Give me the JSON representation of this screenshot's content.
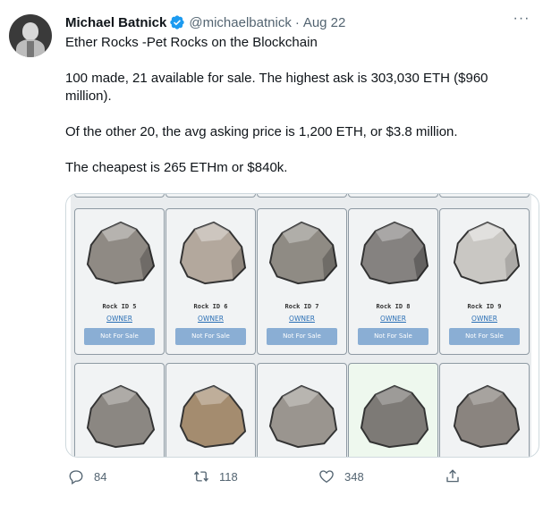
{
  "tweet": {
    "author_name": "Michael Batnick",
    "handle": "@michaelbatnick",
    "separator": "·",
    "date": "Aug 22",
    "more_label": "···",
    "lines": [
      "Ether Rocks -Pet Rocks on the Blockchain",
      "100 made, 21 available for sale. The highest ask is 303,030 ETH ($960 million).",
      "Of the other 20, the avg asking price is 1,200 ETH, or $3.8 million.",
      "The cheapest is 265 ETHm or $840k."
    ]
  },
  "media": {
    "cards": [
      {
        "rock_id": "Rock ID 5",
        "owner": "OWNER",
        "status": "Not For Sale",
        "color": "#8f8a84"
      },
      {
        "rock_id": "Rock ID 6",
        "owner": "OWNER",
        "status": "Not For Sale",
        "color": "#b3a89d"
      },
      {
        "rock_id": "Rock ID 7",
        "owner": "OWNER",
        "status": "Not For Sale",
        "color": "#8f8b84"
      },
      {
        "rock_id": "Rock ID 8",
        "owner": "OWNER",
        "status": "Not For Sale",
        "color": "#858280"
      },
      {
        "rock_id": "Rock ID 9",
        "owner": "OWNER",
        "status": "Not For Sale",
        "color": "#c9c7c3"
      }
    ],
    "bottom_rock_colors": [
      "#8b8782",
      "#a48c6f",
      "#9a958f",
      "#7d7a76",
      "#8a847f"
    ]
  },
  "actions": {
    "replies": "84",
    "retweets": "118",
    "likes": "348"
  },
  "colors": {
    "text": "#0f1419",
    "secondary": "#536471",
    "verified": "#1d9bf0",
    "button": "#8aaed4",
    "link": "#2a6fb5"
  }
}
